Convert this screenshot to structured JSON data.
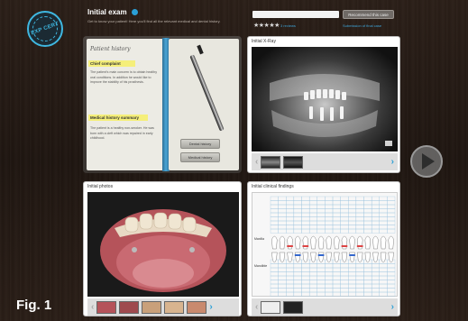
{
  "header": {
    "logo_text": "EXP CERT",
    "title": "Initial exam",
    "subtitle": "Get to know your patient! Here you'll find all the relevant medical and dental history.",
    "recommend_button": "Recommend this case",
    "rating_stars": "★★★★★",
    "reviews_link": "3 reviews",
    "submission_link": "Submission of final case"
  },
  "history": {
    "title": "Patient history",
    "chief_label": "Chief complaint",
    "chief_text": "The patient's main concern is to obtain healthy oral conditions. In addition he would like to improve the stability of his prosthesis.",
    "medical_label": "Medical history summary",
    "medical_text": "The patient is a healthy non-smoker. He was born with a cleft which was repaired in early childhood.",
    "dental_button": "Dental history",
    "medical_button": "Medical history"
  },
  "xray": {
    "title": "Initial X-Ray"
  },
  "photos": {
    "title": "Initial photos"
  },
  "findings": {
    "title": "Initial clinical findings",
    "maxilla_label": "Maxilla",
    "mandible_label": "Mandible"
  },
  "figure_label": "Fig. 1",
  "icons": {
    "play": "play-icon",
    "chevron_left": "chevron-left-icon",
    "chevron_right": "chevron-right-icon",
    "pen": "pen-icon",
    "logo": "certification-seal-icon"
  },
  "colors": {
    "accent": "#2a9fd6",
    "spine": "#4aa6d6",
    "highlight": "#f5ef7a"
  }
}
